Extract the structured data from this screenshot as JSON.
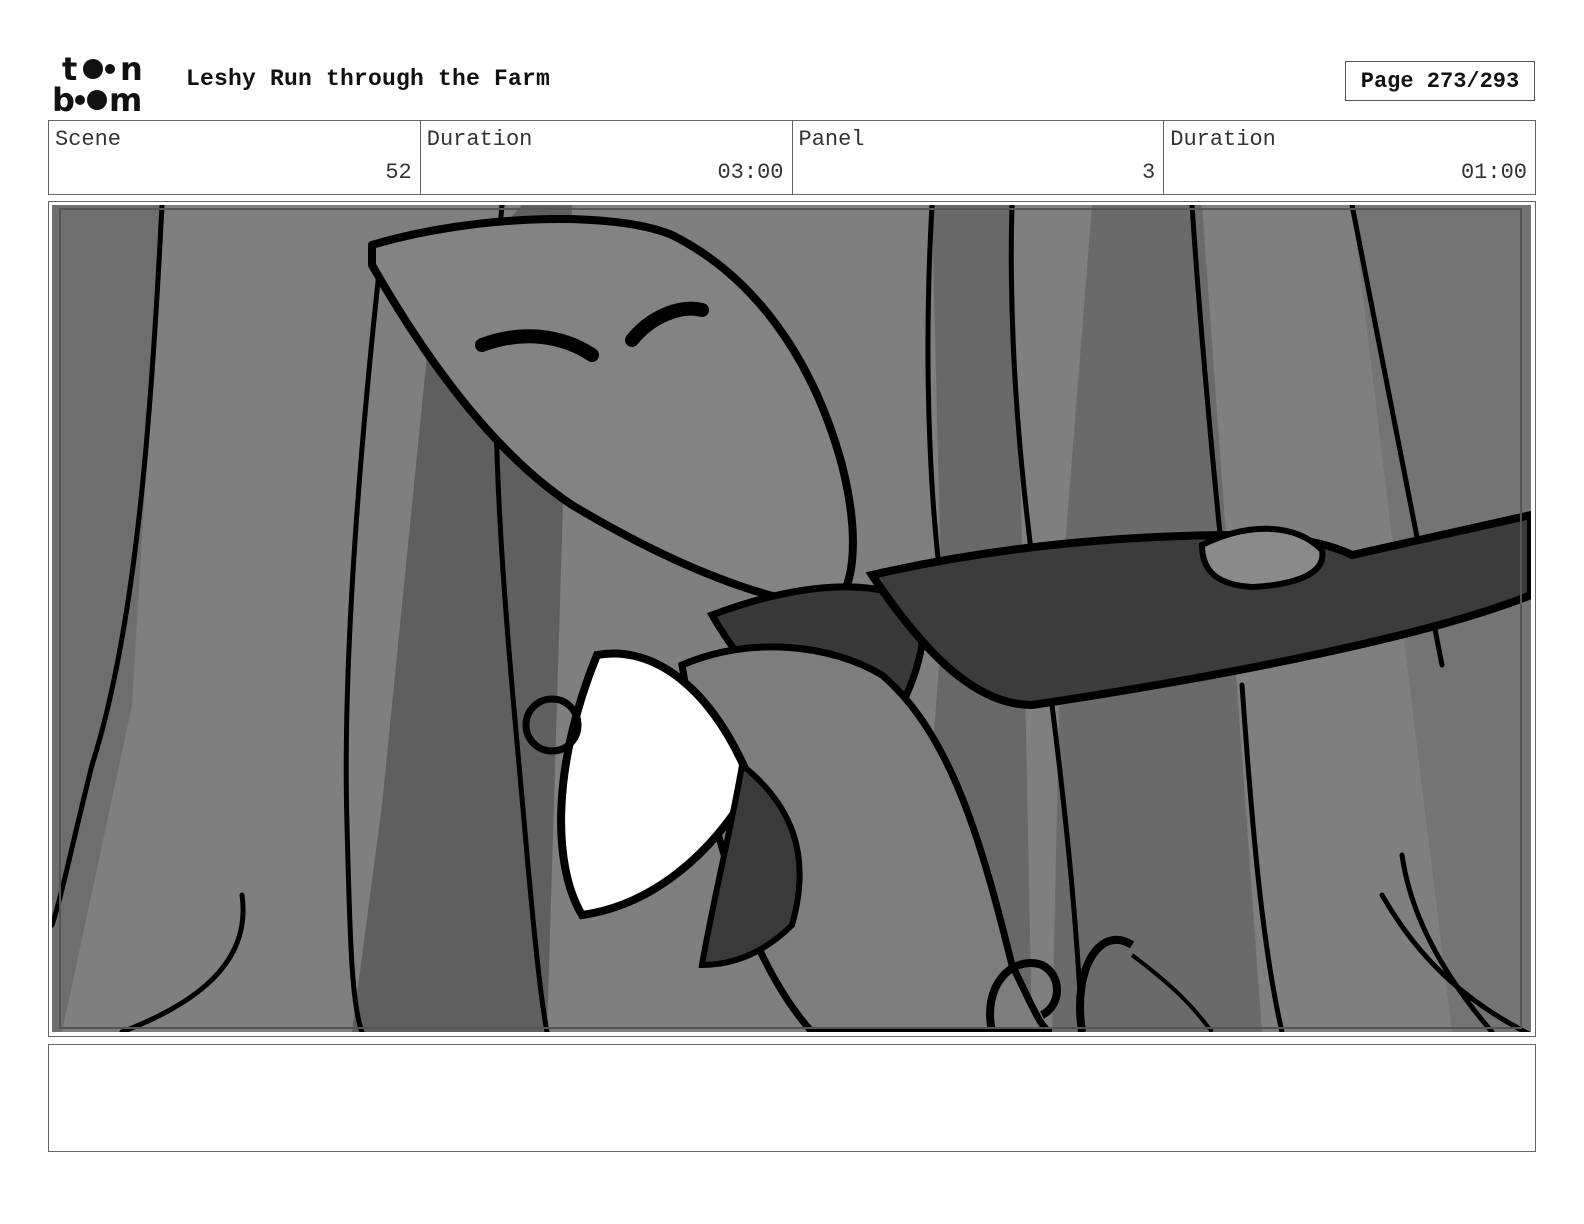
{
  "header": {
    "logo_alt": "toon boom",
    "title": "Leshy Run through the Farm",
    "page_label": "Page 273/293"
  },
  "info": [
    {
      "label": "Scene",
      "value": "52"
    },
    {
      "label": "Duration",
      "value": "03:00"
    },
    {
      "label": "Panel",
      "value": "3"
    },
    {
      "label": "Duration",
      "value": "01:00"
    }
  ],
  "panel": {
    "description_icon": "storyboard-sketch",
    "colors": {
      "light": "#848484",
      "mid": "#6b6b6b",
      "dark": "#3a3a3a",
      "white": "#ffffff",
      "ink": "#000000"
    }
  },
  "notes": {
    "text": ""
  }
}
